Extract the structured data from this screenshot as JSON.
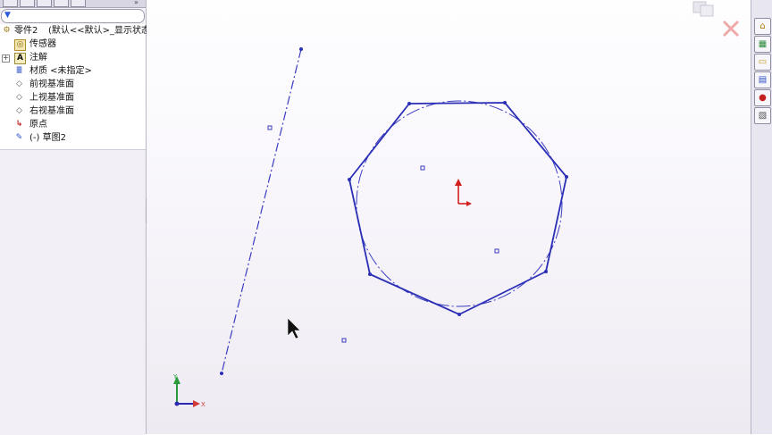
{
  "feature_tree": {
    "part_label": "零件2",
    "part_config": "(默认<<默认>_显示状态",
    "items": [
      {
        "label": "传感器",
        "icon": "sensor-icon"
      },
      {
        "label": "注解",
        "icon": "annotation-icon",
        "expandable": true
      },
      {
        "label": "材质 <未指定>",
        "icon": "material-icon"
      },
      {
        "label": "前视基准面",
        "icon": "plane-icon"
      },
      {
        "label": "上视基准面",
        "icon": "plane-icon"
      },
      {
        "label": "右视基准面",
        "icon": "plane-icon"
      },
      {
        "label": "原点",
        "icon": "origin-icon"
      },
      {
        "label": "(-)  草图2",
        "icon": "sketch-icon"
      }
    ]
  },
  "sketch": {
    "color": "#2b2fb5",
    "construction_color": "#3a3cc0"
  },
  "triad": {
    "x_color": "#d23a3a",
    "y_color": "#2a9a3a"
  },
  "colors": {
    "close_x": "#f3b3b3",
    "origin_red": "#d2201e"
  }
}
